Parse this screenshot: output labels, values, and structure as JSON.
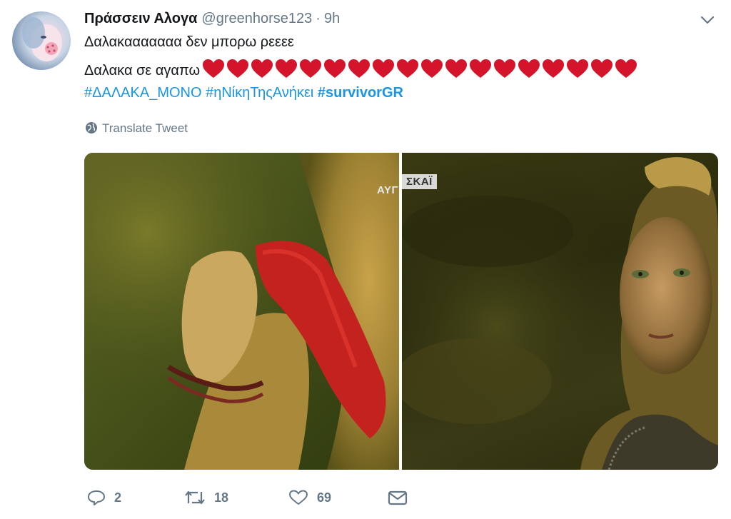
{
  "tweet": {
    "display_name": "Πράσσειν Αλογα",
    "handle": "@greenhorse123",
    "separator": "·",
    "time": "9h",
    "text_line1": "Δαλακααααααα δεν μπορω ρεεεε",
    "text_line2": "Δαλακα σε αγαπω",
    "heart_count": 18,
    "heart_color": "#d4142b",
    "hashtags": [
      "#ΔΑΛΑΚΑ_ΜΟΝΟ",
      "#ηΝίκηΤηςΑνήκει",
      "#survivorGR"
    ],
    "translate_label": "Translate Tweet"
  },
  "media": {
    "left_watermark": "ΑΥΓ",
    "right_watermark": "ΣΚΑΪ"
  },
  "actions": {
    "reply_count": "2",
    "retweet_count": "18",
    "like_count": "69"
  },
  "icons": {
    "caret": "chevron-down-icon",
    "translate": "globe-icon",
    "reply": "reply-icon",
    "retweet": "retweet-icon",
    "like": "heart-outline-icon",
    "message": "envelope-icon"
  },
  "colors": {
    "link": "#1b95e0",
    "secondary_text": "#657786",
    "primary_text": "#14171a"
  }
}
